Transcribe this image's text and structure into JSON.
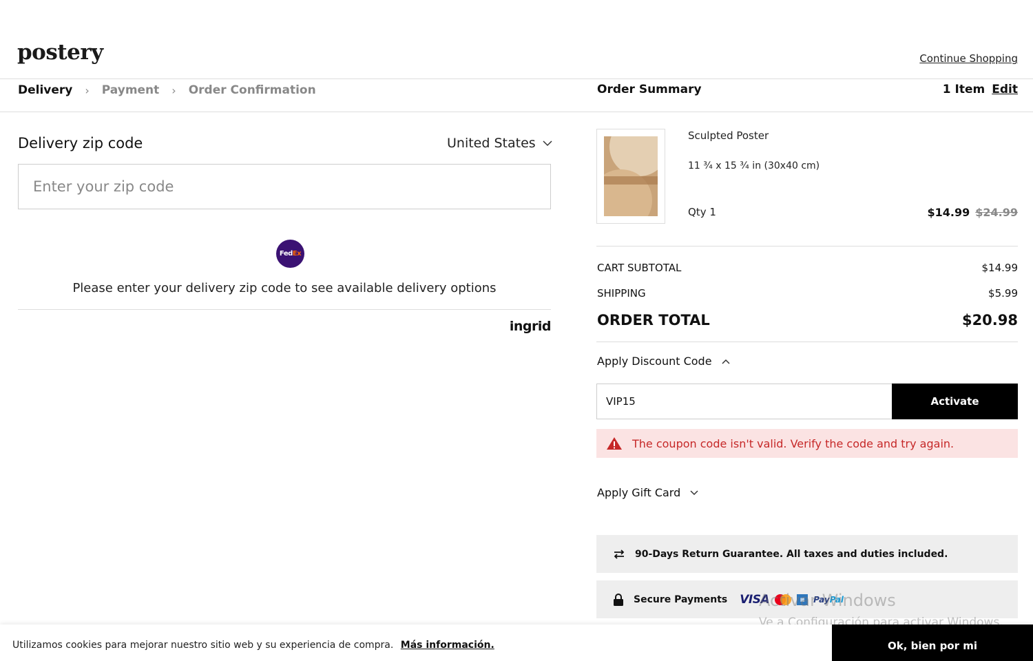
{
  "header": {
    "logo": "postery",
    "continue_shopping": "Continue Shopping"
  },
  "steps": [
    {
      "label": "Delivery"
    },
    {
      "label": "Payment"
    },
    {
      "label": "Order Confirmation"
    }
  ],
  "summary": {
    "title": "Order Summary",
    "item_count": "1 Item",
    "edit_label": "Edit"
  },
  "delivery": {
    "zip_label": "Delivery zip code",
    "country": "United States",
    "zip_placeholder": "Enter your zip code",
    "carrier_logo": "FedEx",
    "message": "Please enter your delivery zip code to see available delivery options",
    "provider": "ingrid"
  },
  "product": {
    "name": "Sculpted Poster",
    "size": "11 ¾ x 15 ¾ in (30x40 cm)",
    "qty": "Qty 1",
    "price": "$14.99",
    "original_price": "$24.99"
  },
  "totals": {
    "subtotal_label": "CART SUBTOTAL",
    "subtotal_value": "$14.99",
    "shipping_label": "SHIPPING",
    "shipping_value": "$5.99",
    "total_label": "ORDER TOTAL",
    "total_value": "$20.98"
  },
  "discount": {
    "label": "Apply Discount Code",
    "value": "VIP15",
    "button": "Activate",
    "error": "The coupon code isn't valid. Verify the code and try again."
  },
  "gift_card": {
    "label": "Apply Gift Card"
  },
  "guarantee": {
    "text": "90-Days Return Guarantee. All taxes and duties included."
  },
  "secure": {
    "text": "Secure Payments",
    "visa": "VISA",
    "paypal_pay": "Pay",
    "paypal_pal": "Pal"
  },
  "watermark": {
    "line1": "Activar Windows",
    "line2": "Ve a Configuración para activar Windows."
  },
  "cookie": {
    "text": "Utilizamos cookies para mejorar nuestro sitio web y su experiencia de compra.",
    "link": "Más información.",
    "button": "Ok, bien por mi"
  },
  "colors": {
    "accent": "#000000",
    "error_text": "#c62828",
    "error_bg": "#fbe3e3",
    "info_bg": "#eeeeee"
  }
}
